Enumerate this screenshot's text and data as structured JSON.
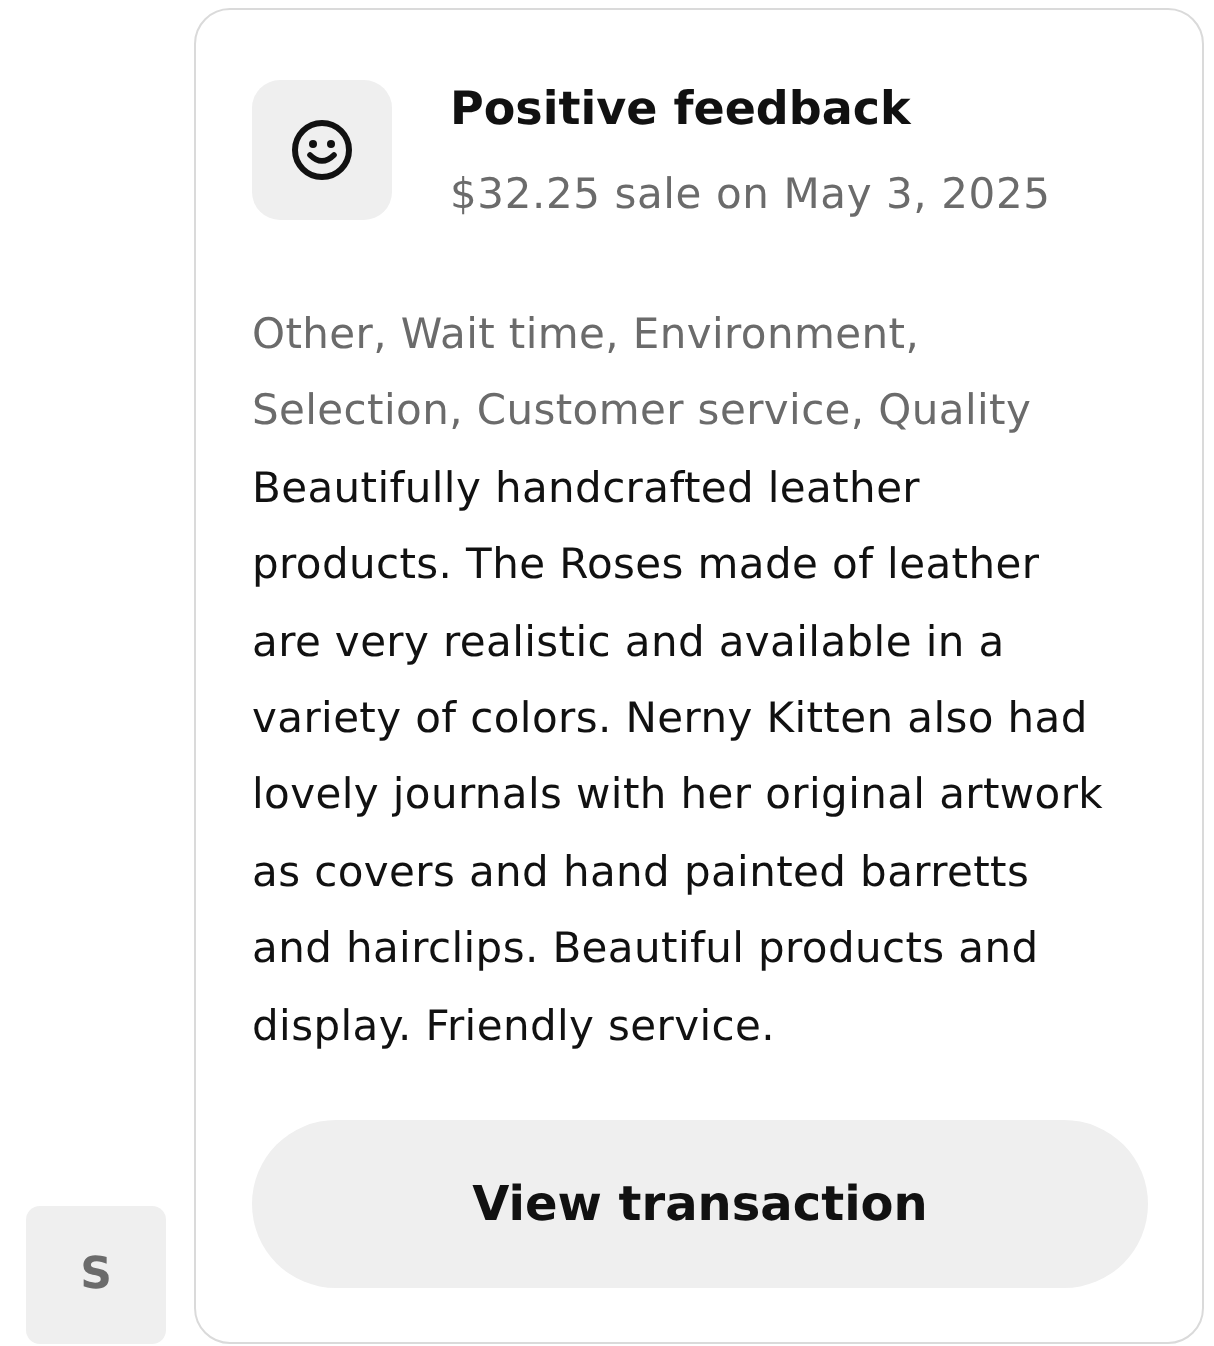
{
  "sender_avatar": {
    "initial": "S"
  },
  "feedback_card": {
    "title": "Positive feedback",
    "subtitle": "$32.25 sale on May 3, 2025",
    "tags": "Other, Wait time, Environment, Selection, Customer service, Quality",
    "comment": "Beautifully handcrafted leather products. The Roses made of leather are very realistic and available in a variety of colors. Nerny Kitten also had lovely journals with her original artwork as covers and hand painted barretts and hairclips. Beautiful products and display. Friendly service.",
    "button": "View transaction"
  }
}
